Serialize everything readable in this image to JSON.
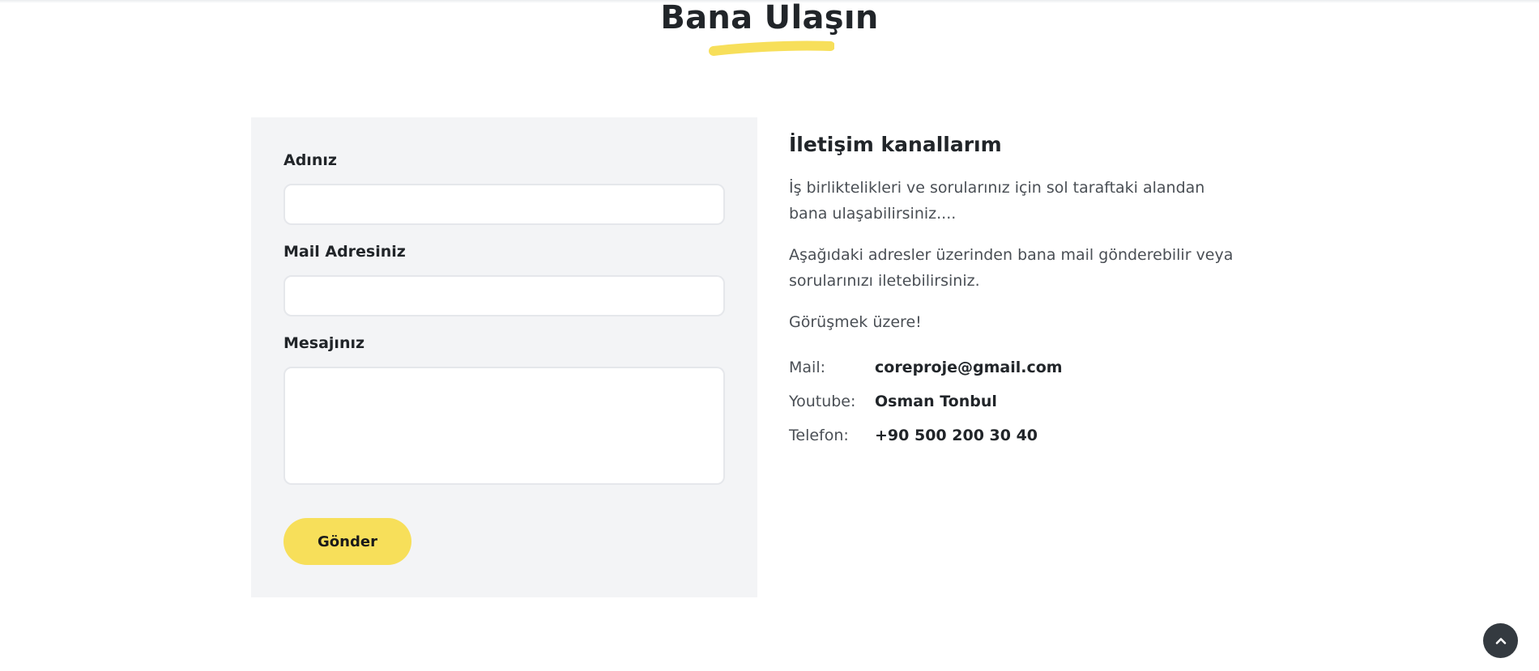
{
  "section": {
    "title": "Bana Ulaşın",
    "accent_color": "#f7df5a"
  },
  "form": {
    "name_label": "Adınız",
    "name_value": "",
    "email_label": "Mail Adresiniz",
    "email_value": "",
    "message_label": "Mesajınız",
    "message_value": "",
    "submit_label": "Gönder",
    "panel_color": "#f3f4f6"
  },
  "info": {
    "heading": "İletişim kanallarım",
    "paragraphs": [
      "İş birliktelikleri ve sorularınız için sol taraftaki alandan bana ulaşabilirsiniz....",
      "Aşağıdaki adresler üzerinden bana mail gönderebilir veya sorularınızı iletebilirsiniz.",
      "Görüşmek üzere!"
    ],
    "contacts": [
      {
        "key": "Mail:",
        "value": "coreproje@gmail.com"
      },
      {
        "key": "Youtube:",
        "value": "Osman Tonbul"
      },
      {
        "key": "Telefon:",
        "value": "+90 500 200 30 40"
      }
    ]
  },
  "icons": {
    "back_to_top": "chevron-up-icon"
  }
}
